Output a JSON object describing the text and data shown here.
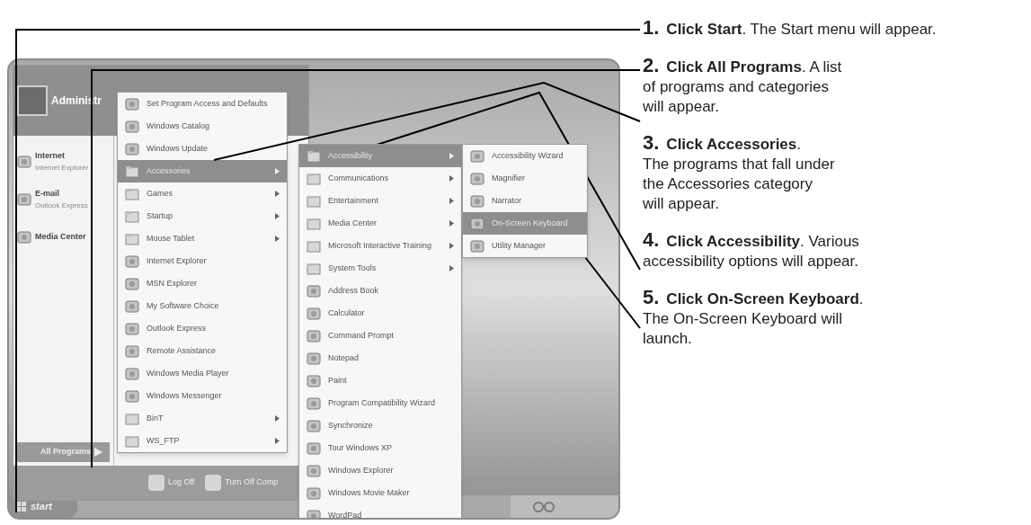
{
  "steps": [
    {
      "number": "1.",
      "lines": [
        "**Click Start**. The Start menu will appear."
      ]
    },
    {
      "number": "2.",
      "lines": [
        "**Click All Programs**. A list",
        "of programs and categories",
        "will appear."
      ]
    },
    {
      "number": "3.",
      "lines": [
        "**Click Accessories**.",
        "The programs that fall under",
        "the Accessories category",
        "will appear."
      ]
    },
    {
      "number": "4.",
      "lines": [
        "**Click Accessibility**. Various",
        "accessibility options will appear."
      ]
    },
    {
      "number": "5.",
      "lines": [
        "**Click On-Screen Keyboard**.",
        "The On-Screen Keyboard will",
        "launch."
      ]
    }
  ],
  "start_menu": {
    "user": "Administr",
    "pinned": [
      {
        "title": "Internet",
        "subtitle": "Internet Explorer"
      },
      {
        "title": "E-mail",
        "subtitle": "Outlook Express"
      },
      {
        "title": "Media Center"
      }
    ],
    "all_programs": "All Programs",
    "log_off": "Log Off",
    "turn_off": "Turn Off Comp"
  },
  "programs_menu": [
    {
      "label": "Set Program Access and Defaults",
      "submenu": false,
      "selected": false
    },
    {
      "label": "Windows Catalog",
      "submenu": false,
      "selected": false
    },
    {
      "label": "Windows Update",
      "submenu": false,
      "selected": false
    },
    {
      "label": "Accessories",
      "submenu": true,
      "selected": true
    },
    {
      "label": "Games",
      "submenu": true,
      "selected": false
    },
    {
      "label": "Startup",
      "submenu": true,
      "selected": false
    },
    {
      "label": "Mouse Tablet",
      "submenu": true,
      "selected": false
    },
    {
      "label": "Internet Explorer",
      "submenu": false,
      "selected": false
    },
    {
      "label": "MSN Explorer",
      "submenu": false,
      "selected": false
    },
    {
      "label": "My Software Choice",
      "submenu": false,
      "selected": false
    },
    {
      "label": "Outlook Express",
      "submenu": false,
      "selected": false
    },
    {
      "label": "Remote Assistance",
      "submenu": false,
      "selected": false
    },
    {
      "label": "Windows Media Player",
      "submenu": false,
      "selected": false
    },
    {
      "label": "Windows Messenger",
      "submenu": false,
      "selected": false
    },
    {
      "label": "BinT",
      "submenu": true,
      "selected": false
    },
    {
      "label": "WS_FTP",
      "submenu": true,
      "selected": false
    }
  ],
  "accessories_menu": [
    {
      "label": "Accessibility",
      "submenu": true,
      "selected": true
    },
    {
      "label": "Communications",
      "submenu": true,
      "selected": false
    },
    {
      "label": "Entertainment",
      "submenu": true,
      "selected": false
    },
    {
      "label": "Media Center",
      "submenu": true,
      "selected": false
    },
    {
      "label": "Microsoft Interactive Training",
      "submenu": true,
      "selected": false
    },
    {
      "label": "System Tools",
      "submenu": true,
      "selected": false
    },
    {
      "label": "Address Book",
      "submenu": false,
      "selected": false
    },
    {
      "label": "Calculator",
      "submenu": false,
      "selected": false
    },
    {
      "label": "Command Prompt",
      "submenu": false,
      "selected": false
    },
    {
      "label": "Notepad",
      "submenu": false,
      "selected": false
    },
    {
      "label": "Paint",
      "submenu": false,
      "selected": false
    },
    {
      "label": "Program Compatibility Wizard",
      "submenu": false,
      "selected": false
    },
    {
      "label": "Synchronize",
      "submenu": false,
      "selected": false
    },
    {
      "label": "Tour Windows XP",
      "submenu": false,
      "selected": false
    },
    {
      "label": "Windows Explorer",
      "submenu": false,
      "selected": false
    },
    {
      "label": "Windows Movie Maker",
      "submenu": false,
      "selected": false
    },
    {
      "label": "WordPad",
      "submenu": false,
      "selected": false
    }
  ],
  "accessibility_menu": [
    {
      "label": "Accessibility Wizard",
      "submenu": false,
      "selected": false
    },
    {
      "label": "Magnifier",
      "submenu": false,
      "selected": false
    },
    {
      "label": "Narrator",
      "submenu": false,
      "selected": false
    },
    {
      "label": "On-Screen Keyboard",
      "submenu": false,
      "selected": true
    },
    {
      "label": "Utility Manager",
      "submenu": false,
      "selected": false
    }
  ],
  "taskbar": {
    "start": "start"
  }
}
